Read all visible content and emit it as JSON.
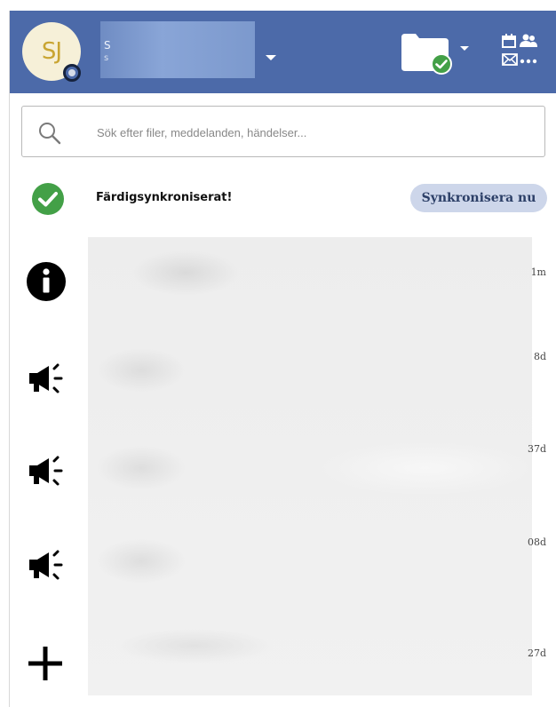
{
  "header": {
    "avatar_initials": "SJ",
    "user_name": "S",
    "user_sub": "s",
    "colors": {
      "bar": "#4c6aa9",
      "sync_ok": "#43a047"
    }
  },
  "search": {
    "placeholder": "Sök efter filer, meddelanden, händelser..."
  },
  "sync": {
    "status_text": "Färdigsynkroniserat!",
    "button_label": "Synkronisera nu"
  },
  "feed": {
    "items": [
      {
        "icon": "info-icon",
        "time": "1m"
      },
      {
        "icon": "megaphone-icon",
        "time": "8d"
      },
      {
        "icon": "megaphone-icon",
        "time": "37d"
      },
      {
        "icon": "megaphone-icon",
        "time": "08d"
      },
      {
        "icon": "plus-icon",
        "time": "27d"
      }
    ]
  }
}
